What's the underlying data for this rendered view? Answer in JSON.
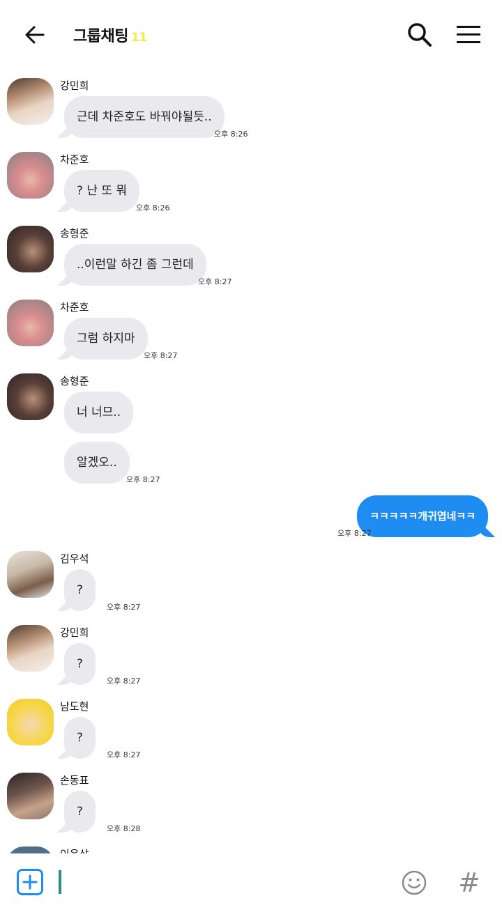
{
  "header": {
    "back_icon": "arrow-left-icon",
    "title": "그룹채팅",
    "member_count": "11",
    "search_icon": "search-icon",
    "menu_icon": "hamburger-menu-icon"
  },
  "messages": [
    {
      "sender": "강민희",
      "text": "근데 차준호도 바꿔야될듯..",
      "time": "오후 8:26"
    },
    {
      "sender": "차준호",
      "text": "? 난 또 뭐",
      "time": "오후 8:26"
    },
    {
      "sender": "송형준",
      "text": "..이런말 하긴 좀 그런데",
      "time": "오후 8:27"
    },
    {
      "sender": "차준호",
      "text": "그럼 하지마",
      "time": "오후 8:27"
    },
    {
      "sender": "송형준",
      "text": "너 너므..",
      "text2": "알겠오..",
      "time": "오후 8:27"
    },
    {
      "sender": "me",
      "text": "ㅋㅋㅋㅋㅋ개귀엽네ㅋㅋ",
      "time": "오후 8:27"
    },
    {
      "sender": "김우석",
      "text": "?",
      "time": "오후 8:27"
    },
    {
      "sender": "강민희",
      "text": "?",
      "time": "오후 8:27"
    },
    {
      "sender": "남도현",
      "text": "?",
      "time": "오후 8:27"
    },
    {
      "sender": "손동표",
      "text": "?",
      "time": "오후 8:28"
    },
    {
      "sender": "이은상"
    }
  ],
  "composer": {
    "add_icon": "plus-square-icon",
    "input_value": "",
    "emoji_icon": "smiley-icon",
    "hashtag_label": "#"
  },
  "colors": {
    "accent": "#1f8cf2",
    "bubble_other": "#e9e9ee",
    "count": "#f7e84a"
  }
}
